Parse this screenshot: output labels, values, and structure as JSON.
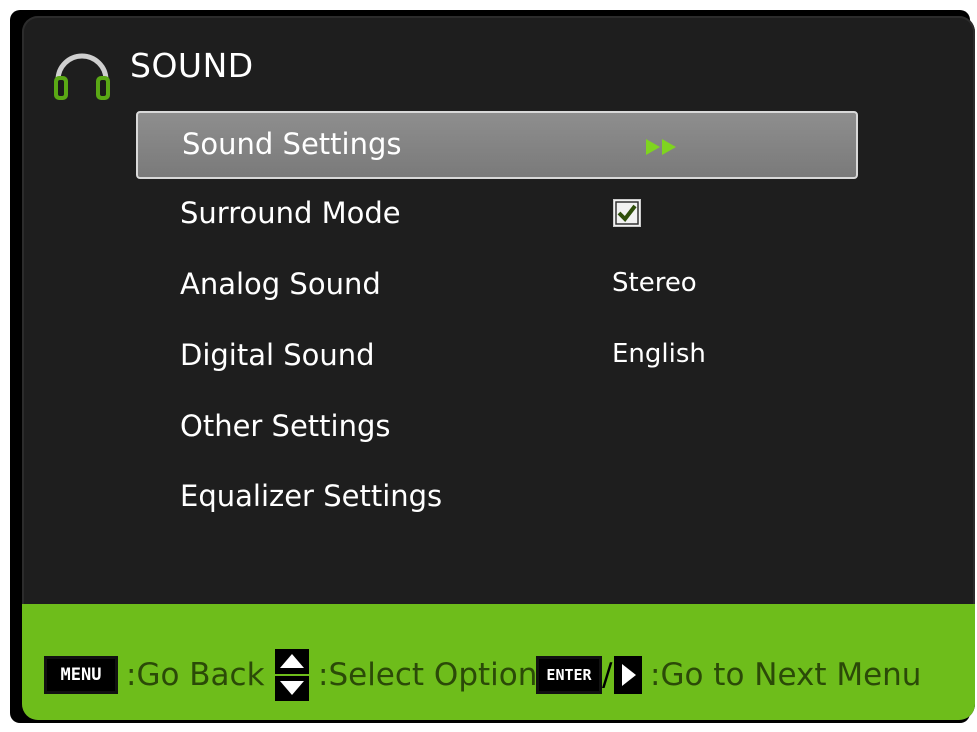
{
  "header": {
    "title": "SOUND",
    "icon": "headphones-icon"
  },
  "menu": {
    "items": [
      {
        "label": "Sound Settings",
        "value": "",
        "indicator": "double-arrow-right-icon",
        "selected": true
      },
      {
        "label": "Surround Mode",
        "value": "",
        "indicator": "checkbox-checked-icon",
        "selected": false
      },
      {
        "label": "Analog Sound",
        "value": "Stereo",
        "selected": false
      },
      {
        "label": "Digital Sound",
        "value": "English",
        "selected": false
      },
      {
        "label": "Other Settings",
        "value": "",
        "selected": false
      },
      {
        "label": "Equalizer Settings",
        "value": "",
        "selected": false
      }
    ]
  },
  "footer": {
    "menu_key": "MENU",
    "menu_hint": ":Go Back",
    "select_hint": ":Select Option",
    "enter_key": "ENTER",
    "slash": "/",
    "next_hint": ":Go to Next Menu"
  },
  "colors": {
    "accent_green": "#6ebd1b",
    "panel_bg": "#1e1e1e",
    "selected_bg": "#888888",
    "hint_text": "#2b4a08"
  }
}
